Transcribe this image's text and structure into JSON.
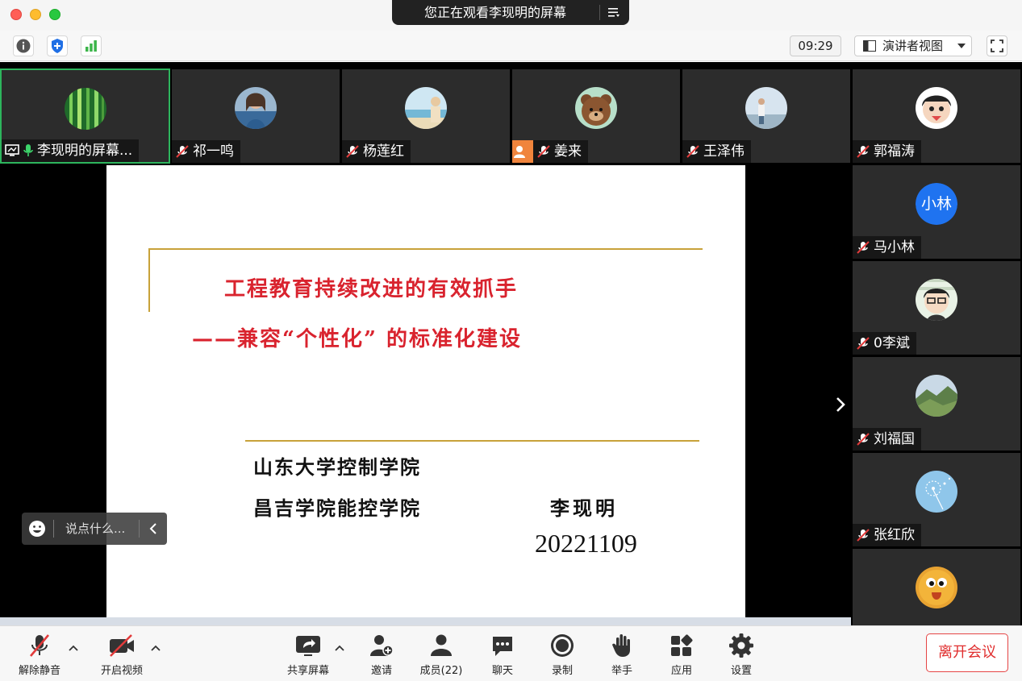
{
  "window": {
    "viewing_banner": "您正在观看李现明的屏幕"
  },
  "topbar": {
    "clock": "09:29",
    "view_mode": "演讲者视图"
  },
  "participants": [
    {
      "name": "李现明的屏幕...",
      "mic": "on",
      "sharing": true,
      "active": true
    },
    {
      "name": "祁一鸣",
      "mic": "muted"
    },
    {
      "name": "杨莲红",
      "mic": "muted"
    },
    {
      "name": "姜来",
      "mic": "muted",
      "host": true
    },
    {
      "name": "王泽伟",
      "mic": "muted"
    },
    {
      "name": "郭福涛",
      "mic": "muted"
    },
    {
      "name": "马小林",
      "mic": "muted",
      "initials": "小林"
    },
    {
      "name": "0李斌",
      "mic": "muted"
    },
    {
      "name": "刘福国",
      "mic": "muted"
    },
    {
      "name": "张红欣",
      "mic": "muted"
    }
  ],
  "slide": {
    "title_line1": "工程教育持续改进的有效抓手",
    "title_line2": "——兼容“个性化” 的标准化建设",
    "org_line1": "山东大学控制学院",
    "org_line2": "昌吉学院能控学院",
    "author": "李现明",
    "date": "20221109"
  },
  "chat": {
    "placeholder": "说点什么..."
  },
  "toolbar": {
    "unmute": "解除静音",
    "start_video": "开启视频",
    "share_screen": "共享屏幕",
    "invite": "邀请",
    "members": "成员(22)",
    "chat": "聊天",
    "record": "录制",
    "raise_hand": "举手",
    "apps": "应用",
    "settings": "设置",
    "leave": "离开会议"
  },
  "colors": {
    "active_border": "#2db55d",
    "slide_title": "#d9232e",
    "slide_rule": "#c8a23a",
    "leave": "#e02d2d",
    "host_badge": "#f0843c",
    "initials_avatar": "#1f73f0"
  }
}
